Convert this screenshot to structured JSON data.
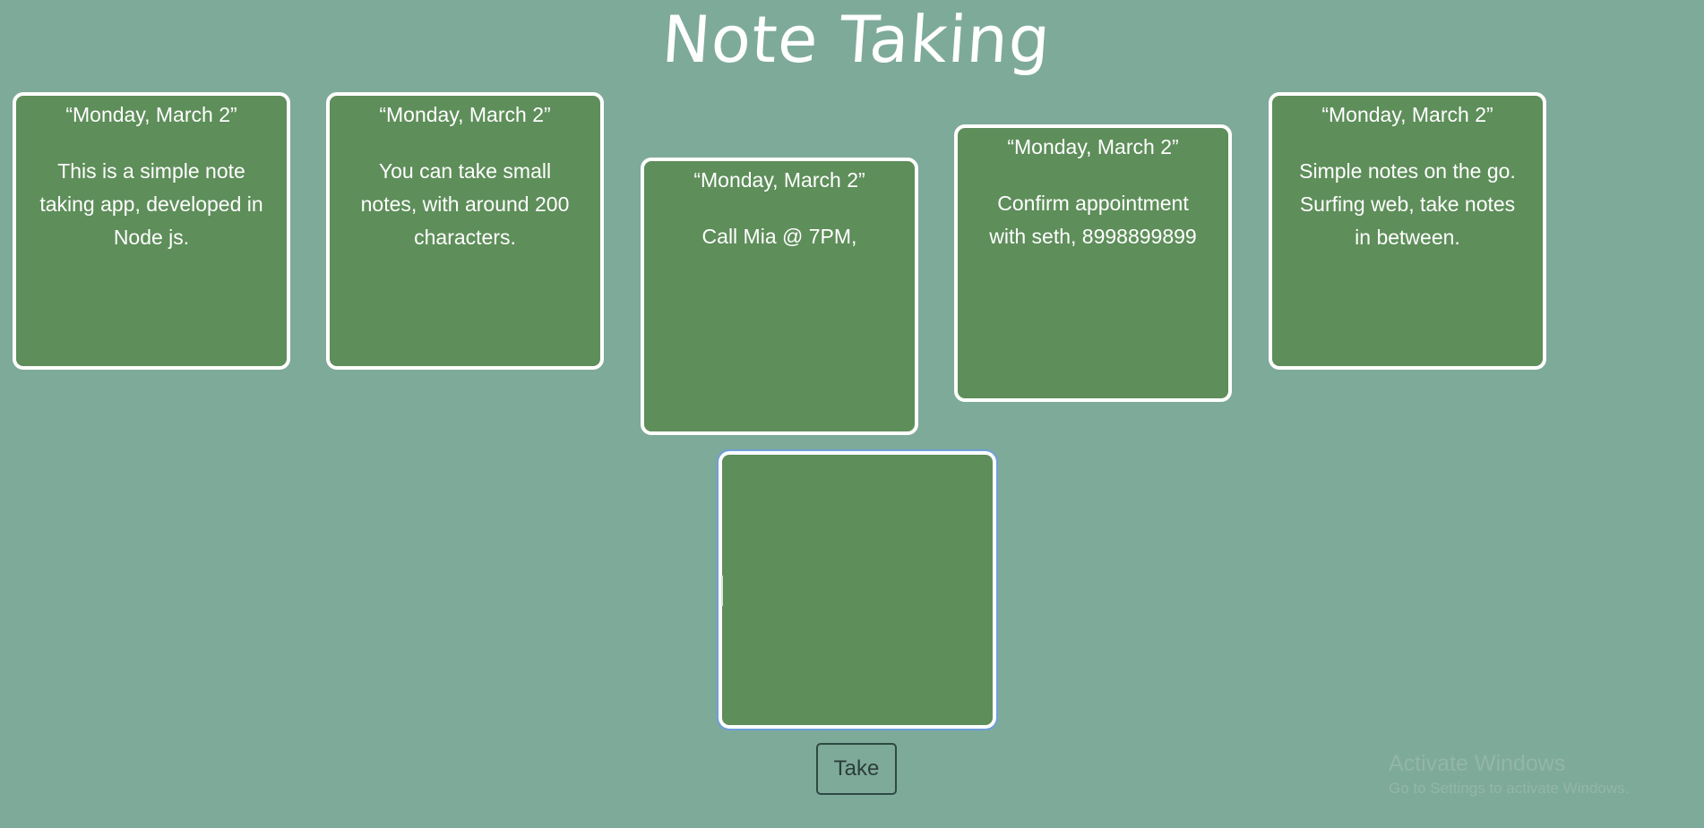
{
  "header": {
    "title": "Note Taking"
  },
  "notes": [
    {
      "date": "“Monday, March 2”",
      "text": "This is a simple note taking app, developed in Node js."
    },
    {
      "date": "“Monday, March 2”",
      "text": "You can take small notes, with around 200 characters."
    },
    {
      "date": "“Monday, March 2”",
      "text": "Call Mia @ 7PM,"
    },
    {
      "date": "“Monday, March 2”",
      "text": "Confirm appointment with seth, 8998899899"
    },
    {
      "date": "“Monday, March 2”",
      "text": "Simple notes on the go. Surfing web, take notes in between."
    }
  ],
  "composer": {
    "value": "",
    "placeholder": ""
  },
  "actions": {
    "take_label": "Take"
  },
  "watermark": {
    "title": "Activate Windows",
    "subtitle": "Go to Settings to activate Windows."
  },
  "colors": {
    "background": "#7eaa9a",
    "note_fill": "#5e8e5a",
    "note_border": "#ffffff",
    "focus_outline": "#6f9fd8"
  }
}
